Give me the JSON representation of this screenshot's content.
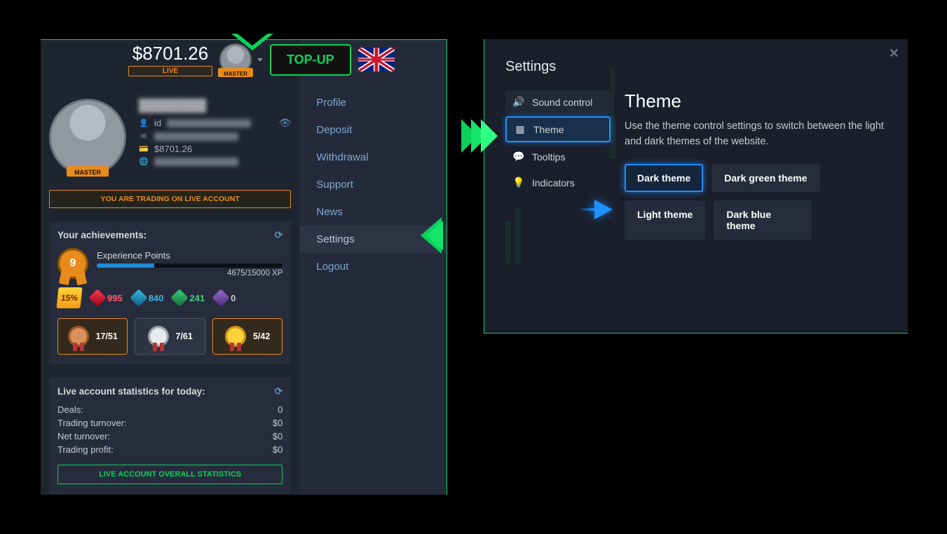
{
  "header": {
    "balance": "$8701.26",
    "live_label": "LIVE",
    "avatar_badge": "MASTER",
    "topup_label": "TOP-UP"
  },
  "profile": {
    "avatar_badge": "MASTER",
    "id_prefix": "id",
    "balance": "$8701.26",
    "live_account_strip": "YOU ARE TRADING ON LIVE ACCOUNT"
  },
  "achievements": {
    "header": "Your achievements:",
    "level": "9",
    "xp_label": "Experience Points",
    "xp_text": "4675/15000 XP",
    "discount": "15%",
    "gems": {
      "red": "995",
      "blue": "840",
      "green": "241",
      "purple": "0"
    },
    "medals": {
      "bronze": "17/51",
      "silver": "7/61",
      "gold": "5/42"
    }
  },
  "stats": {
    "header": "Live account statistics for today:",
    "rows": [
      {
        "label": "Deals:",
        "value": "0"
      },
      {
        "label": "Trading turnover:",
        "value": "$0"
      },
      {
        "label": "Net turnover:",
        "value": "$0"
      },
      {
        "label": "Trading profit:",
        "value": "$0"
      }
    ],
    "overall_btn": "LIVE ACCOUNT OVERALL STATISTICS"
  },
  "menu": {
    "profile": "Profile",
    "deposit": "Deposit",
    "withdrawal": "Withdrawal",
    "support": "Support",
    "news": "News",
    "settings": "Settings",
    "logout": "Logout"
  },
  "settings": {
    "title": "Settings",
    "nav": {
      "sound": "Sound control",
      "theme": "Theme",
      "tooltips": "Tooltips",
      "indicators": "Indicators"
    },
    "theme_panel": {
      "title": "Theme",
      "desc": "Use the theme control settings to switch between the light and dark themes of the website.",
      "options": {
        "dark": "Dark theme",
        "dark_green": "Dark green theme",
        "light": "Light theme",
        "dark_blue": "Dark blue theme"
      }
    }
  }
}
